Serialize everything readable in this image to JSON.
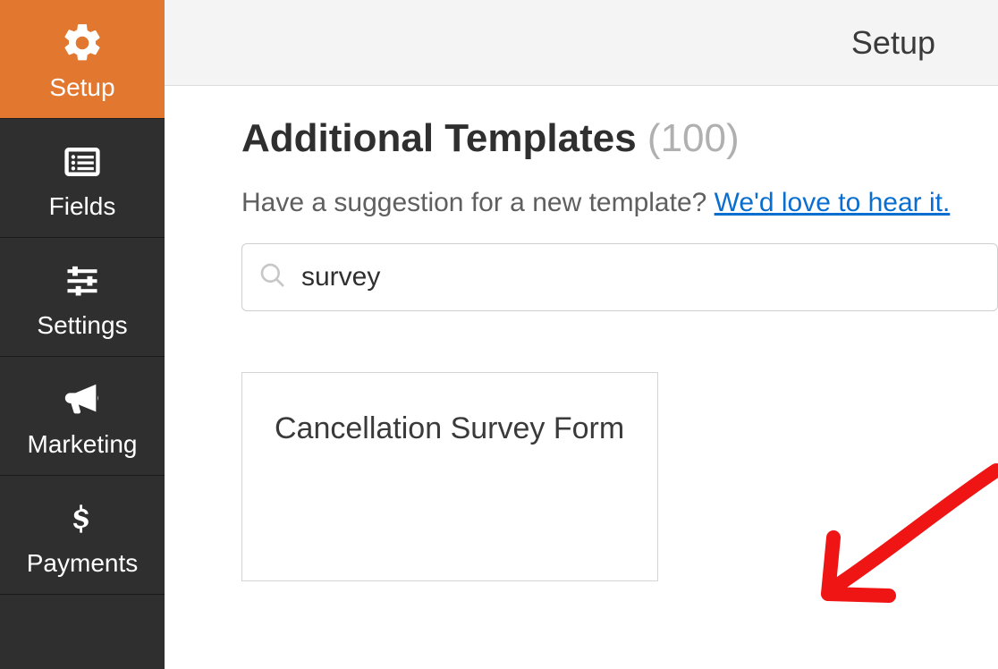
{
  "sidebar": {
    "items": [
      {
        "label": "Setup"
      },
      {
        "label": "Fields"
      },
      {
        "label": "Settings"
      },
      {
        "label": "Marketing"
      },
      {
        "label": "Payments"
      }
    ]
  },
  "topbar": {
    "title": "Setup"
  },
  "templates": {
    "heading": "Additional Templates",
    "count": "(100)",
    "suggestion_prefix": "Have a suggestion for a new template? ",
    "suggestion_link": "We'd love to hear it.",
    "search_value": "survey",
    "card_title": "Cancellation Survey Form"
  }
}
